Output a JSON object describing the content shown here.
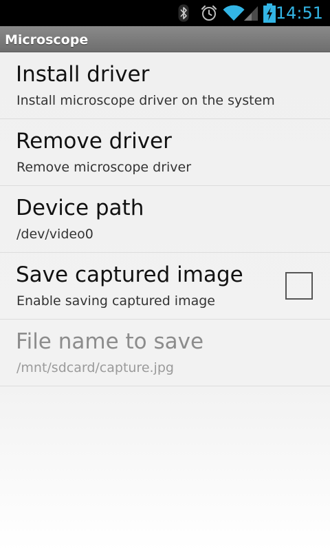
{
  "status_bar": {
    "time": "14:51",
    "icons": [
      "bluetooth-icon",
      "alarm-icon",
      "wifi-icon",
      "signal-icon",
      "battery-charging-icon"
    ],
    "accent_color": "#33b5e5"
  },
  "app": {
    "title": "Microscope"
  },
  "preferences": [
    {
      "title": "Install driver",
      "summary": "Install microscope driver on the system",
      "enabled": true
    },
    {
      "title": "Remove driver",
      "summary": "Remove microscope driver",
      "enabled": true
    },
    {
      "title": "Device path",
      "summary": "/dev/video0",
      "enabled": true
    },
    {
      "title": "Save captured image",
      "summary": "Enable saving captured image",
      "enabled": true,
      "checkbox": {
        "checked": false
      }
    },
    {
      "title": "File name to save",
      "summary": "/mnt/sdcard/capture.jpg",
      "enabled": false
    }
  ]
}
